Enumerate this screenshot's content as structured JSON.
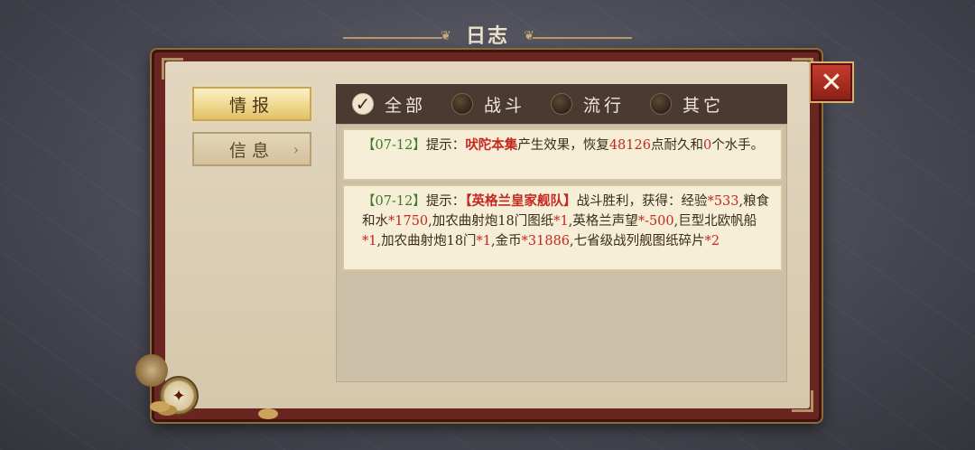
{
  "window": {
    "title": "日志"
  },
  "close_icon": "close-x-icon",
  "sidebar": {
    "tabs": [
      {
        "label": "情报",
        "active": true
      },
      {
        "label": "信息",
        "active": false,
        "icon": "chevron-right-icon"
      }
    ]
  },
  "filters": [
    {
      "label": "全部",
      "checked": true
    },
    {
      "label": "战斗",
      "checked": false
    },
    {
      "label": "流行",
      "checked": false
    },
    {
      "label": "其它",
      "checked": false
    }
  ],
  "log": {
    "entries": [
      {
        "date": "【07-12】",
        "prefix": "提示：",
        "item": "吠陀本集",
        "t1": "产生效果，恢复",
        "v1": "48126",
        "t2": "点耐久和",
        "v2": "0",
        "t3": "个水手。"
      },
      {
        "date": "【07-12】",
        "prefix": "提示：",
        "fleet": "【英格兰皇家舰队】",
        "t1": "战斗胜利，获得：经验",
        "v1": "*533",
        "t2": ",粮食和水",
        "v2": "*1750",
        "t3": ",加农曲射炮18门图纸",
        "v3": "*1",
        "t4": ",英格兰声望",
        "v4": "*-500",
        "t5": ",巨型北欧帆船",
        "v5": "*1",
        "t6": ",加农曲射炮18门",
        "v6": "*1",
        "t7": ",金币",
        "v7": "*31886",
        "t8": ",七省级战列舰图纸碎片",
        "v8": "*2"
      }
    ]
  },
  "colors": {
    "date": "#3c7a2a",
    "highlight": "#c42820",
    "book_cover": "#6b2520",
    "filter_bar": "#4a3a32"
  }
}
